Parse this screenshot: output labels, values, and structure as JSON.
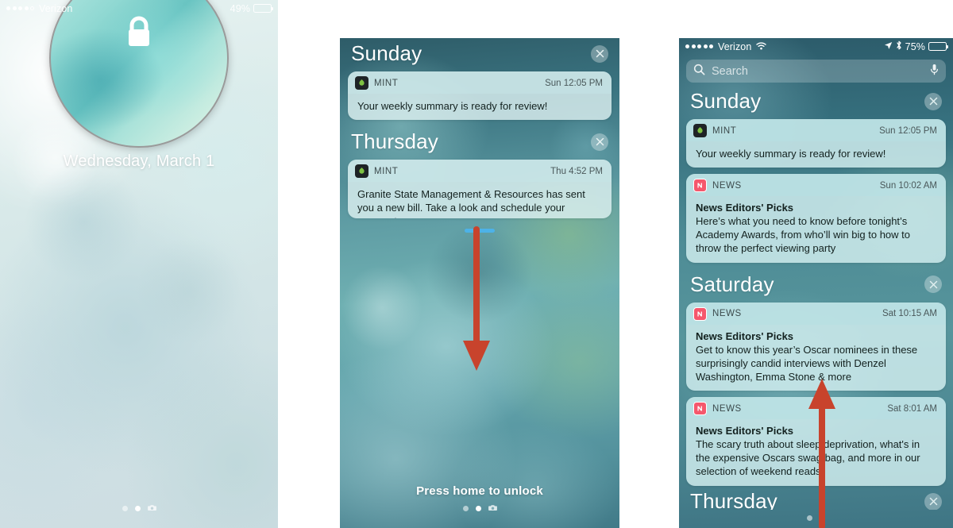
{
  "screens": {
    "lock": {
      "status": {
        "carrier": "Verizon",
        "signal_filled": 4,
        "signal_hollow": 1,
        "battery_pct": "49%",
        "battery_level": 49
      },
      "lock_icon": "lock-icon",
      "datetime_text": "Wednesday, March 1",
      "magnifier": "magnifier-circle",
      "page_dots": {
        "count": 3,
        "active_index": 1,
        "camera_index": 2
      }
    },
    "lockscreen_notifications": {
      "sections": [
        {
          "day": "Sunday",
          "clear_label": "×",
          "notifications": [
            {
              "app": "MINT",
              "app_icon": "mint-app-icon",
              "time": "Sun 12:05 PM",
              "title": "",
              "text": "Your weekly summary is ready for review!"
            }
          ]
        },
        {
          "day": "Thursday",
          "clear_label": "×",
          "notifications": [
            {
              "app": "MINT",
              "app_icon": "mint-app-icon",
              "time": "Thu 4:52 PM",
              "title": "",
              "text": "Granite State Management & Resources has sent you a new bill. Take a look and schedule your payment soon."
            }
          ]
        }
      ],
      "grabber": "drag-handle",
      "unlock_text": "Press home to unlock",
      "page_dots": {
        "count": 3,
        "active_index": 1,
        "camera_index": 2
      },
      "arrow": "swipe-down-arrow"
    },
    "notification_center": {
      "status": {
        "carrier": "Verizon",
        "signal_filled": 5,
        "signal_hollow": 0,
        "wifi": "wifi-icon",
        "location": "location-arrow-icon",
        "bluetooth": "bluetooth-icon",
        "battery_pct": "75%",
        "battery_level": 75
      },
      "search": {
        "placeholder": "Search",
        "icon": "search-icon",
        "mic_icon": "microphone-icon"
      },
      "sections": [
        {
          "day": "Sunday",
          "clear_label": "×",
          "notifications": [
            {
              "app": "MINT",
              "app_icon": "mint-app-icon",
              "time": "Sun 12:05 PM",
              "title": "",
              "text": "Your weekly summary is ready for review!"
            },
            {
              "app": "NEWS",
              "app_icon": "news-app-icon",
              "time": "Sun 10:02 AM",
              "title": "News Editors' Picks",
              "text": "Here’s what you need to know before tonight’s Academy Awards, from who’ll win big to how to throw the perfect viewing party"
            }
          ]
        },
        {
          "day": "Saturday",
          "clear_label": "×",
          "notifications": [
            {
              "app": "NEWS",
              "app_icon": "news-app-icon",
              "time": "Sat 10:15 AM",
              "title": "News Editors' Picks",
              "text": "Get to know this year’s Oscar nominees in these surprisingly candid interviews with Denzel Washington, Emma Stone & more"
            },
            {
              "app": "NEWS",
              "app_icon": "news-app-icon",
              "time": "Sat 8:01 AM",
              "title": "News Editors' Picks",
              "text": "The scary truth about sleep deprivation, what's in the expensive Oscars swag bag, and more in our selection of weekend reads"
            }
          ]
        },
        {
          "day": "Thursday",
          "clear_label": "×",
          "notifications": []
        }
      ],
      "page_dots": {
        "count": 2,
        "active_index": 1
      },
      "arrow": "swipe-up-arrow"
    }
  },
  "colors": {
    "arrow_red": "#c8432c",
    "grabber_blue": "#4db2e8",
    "news_icon": "#f5576c",
    "mint_icon_bg": "#1e2326",
    "mint_leaf": "#7ec242"
  }
}
